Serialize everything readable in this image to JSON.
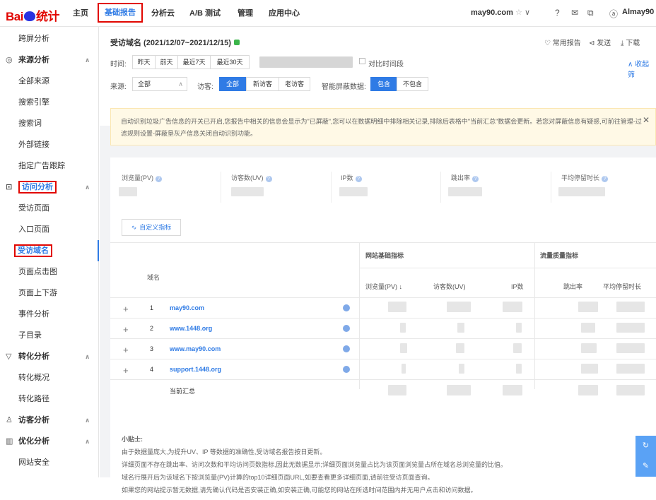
{
  "logo": {
    "text_a": "Bai",
    "text_b": "du",
    "text_c": "统计"
  },
  "nav": [
    {
      "label": "主页"
    },
    {
      "label": "基础报告"
    },
    {
      "label": "分析云"
    },
    {
      "label": "A/B 测试"
    },
    {
      "label": "管理"
    },
    {
      "label": "应用中心"
    }
  ],
  "header": {
    "site": "may90.com",
    "star": "☆",
    "caret": "∨",
    "help": "?",
    "mail": "✉",
    "copy": "⧉",
    "user_icon": "ⓐ",
    "user": "Almay90"
  },
  "sidebar": {
    "items": [
      {
        "label": "跨屏分析",
        "type": "child"
      },
      {
        "label": "来源分析",
        "type": "group",
        "icon": "◎"
      },
      {
        "label": "全部来源",
        "type": "child"
      },
      {
        "label": "搜索引擎",
        "type": "child"
      },
      {
        "label": "搜索词",
        "type": "child"
      },
      {
        "label": "外部链接",
        "type": "child"
      },
      {
        "label": "指定广告跟踪",
        "type": "child"
      },
      {
        "label": "访问分析",
        "type": "group",
        "icon": "⊡"
      },
      {
        "label": "受访页面",
        "type": "child"
      },
      {
        "label": "入口页面",
        "type": "child"
      },
      {
        "label": "受访域名",
        "type": "child"
      },
      {
        "label": "页面点击图",
        "type": "child"
      },
      {
        "label": "页面上下游",
        "type": "child"
      },
      {
        "label": "事件分析",
        "type": "child"
      },
      {
        "label": "子目录",
        "type": "child"
      },
      {
        "label": "转化分析",
        "type": "group",
        "icon": "▽"
      },
      {
        "label": "转化概况",
        "type": "child"
      },
      {
        "label": "转化路径",
        "type": "child"
      },
      {
        "label": "访客分析",
        "type": "group",
        "icon": "♙"
      },
      {
        "label": "优化分析",
        "type": "group",
        "icon": "▥"
      },
      {
        "label": "网站安全",
        "type": "child"
      }
    ],
    "chevron": "∧"
  },
  "report": {
    "title": "受访域名 (2021/12/07~2021/12/15)",
    "actions": [
      "♡ 常用报告",
      "⊲ 发送",
      "⤓ 下载"
    ],
    "collapse": "∧ 收起筛",
    "time_label": "时间:",
    "time_buttons": [
      "昨天",
      "前天",
      "最近7天",
      "最近30天"
    ],
    "compare": "对比时间段",
    "source_label": "来源:",
    "source_value": "全部",
    "visitor_label": "访客:",
    "visitor_buttons": [
      "全部",
      "新访客",
      "老访客"
    ],
    "filter_label": "智能屏蔽数据:",
    "filter_buttons": [
      "包含",
      "不包含"
    ]
  },
  "notice": {
    "text": "自动识别垃圾广告信息的开关已开启,您报告中相关的信息会显示为\"已屏蔽\",您可以在数据明细中排除相关记录,排除后表格中\"当前汇总\"数据会更新。若您对屏蔽信息有疑惑,可前往管理-过滤规则设置-屏蔽垦灰产信息关闭自动识别功能。",
    "close": "✕"
  },
  "metrics": [
    {
      "label": "浏览量(PV)"
    },
    {
      "label": "访客数(UV)"
    },
    {
      "label": "IP数"
    },
    {
      "label": "跳出率"
    },
    {
      "label": "平均停留时长"
    }
  ],
  "custom_button": "自定义指标",
  "table": {
    "domain_header": "域名",
    "group1": "网站基础指标",
    "group2": "流量质量指标",
    "cols": [
      "浏览量(PV) ↓",
      "访客数(UV)",
      "IP数",
      "跳出率",
      "平均停留时长"
    ],
    "rows": [
      {
        "index": "1",
        "domain": "may90.com"
      },
      {
        "index": "2",
        "domain": "www.1448.org"
      },
      {
        "index": "3",
        "domain": "www.may90.com"
      },
      {
        "index": "4",
        "domain": "support.1448.org"
      }
    ],
    "summary": "当前汇总",
    "plus": "+"
  },
  "tips": {
    "title": "小贴士:",
    "lines": [
      "由于数据量庞大,为提升UV、IP 等数据的准确性,受访域名报告按日更新。",
      "详细页面不存在跳出率、访问次数和平均访问页数指标,因此无数据显示;详细页面浏览量占比为该页面浏览量占所在域名总浏览量的比值。",
      "域名行展开后为该域名下按浏览量(PV)计算的top10详细页面URL,如要查看更多详细页面,请前往受访页面查询。",
      "如果您的网站提示暂无数据,请先确认代码是否安装正确,如安装正确,可能您的网站在所选时间范围内并无用户点击和访问数据。"
    ]
  },
  "float_buttons": [
    "↻",
    "✎"
  ]
}
